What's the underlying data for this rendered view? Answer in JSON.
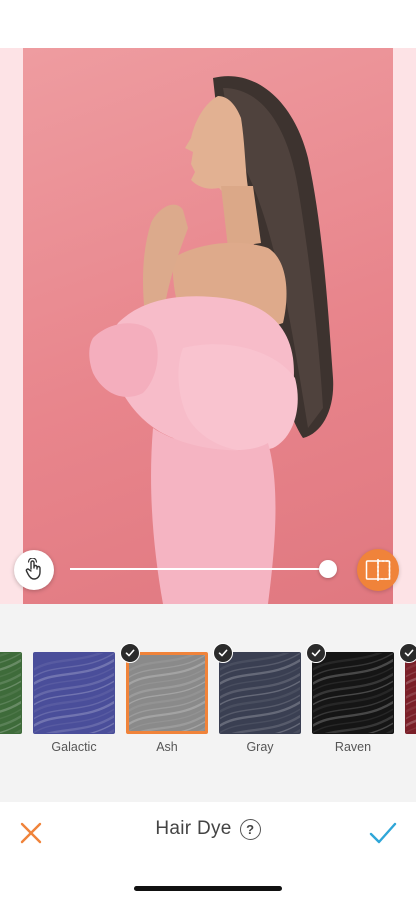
{
  "editor": {
    "slider_value_percent": 100
  },
  "swatches": [
    {
      "label": "en",
      "selected": false,
      "checked": false,
      "color": "#3e6b3a"
    },
    {
      "label": "Galactic",
      "selected": false,
      "checked": false,
      "color": "#4a4e9a"
    },
    {
      "label": "Ash",
      "selected": true,
      "checked": true,
      "color": "#8a8a8a"
    },
    {
      "label": "Gray",
      "selected": false,
      "checked": true,
      "color": "#3a3f52"
    },
    {
      "label": "Raven",
      "selected": false,
      "checked": true,
      "color": "#151515"
    },
    {
      "label": "",
      "selected": false,
      "checked": true,
      "color": "#7a1f28"
    }
  ],
  "bottom_bar": {
    "title": "Hair Dye",
    "help_glyph": "?"
  },
  "colors": {
    "accent": "#f0833a",
    "confirm": "#2fa6d8",
    "cancel": "#f0833a"
  }
}
